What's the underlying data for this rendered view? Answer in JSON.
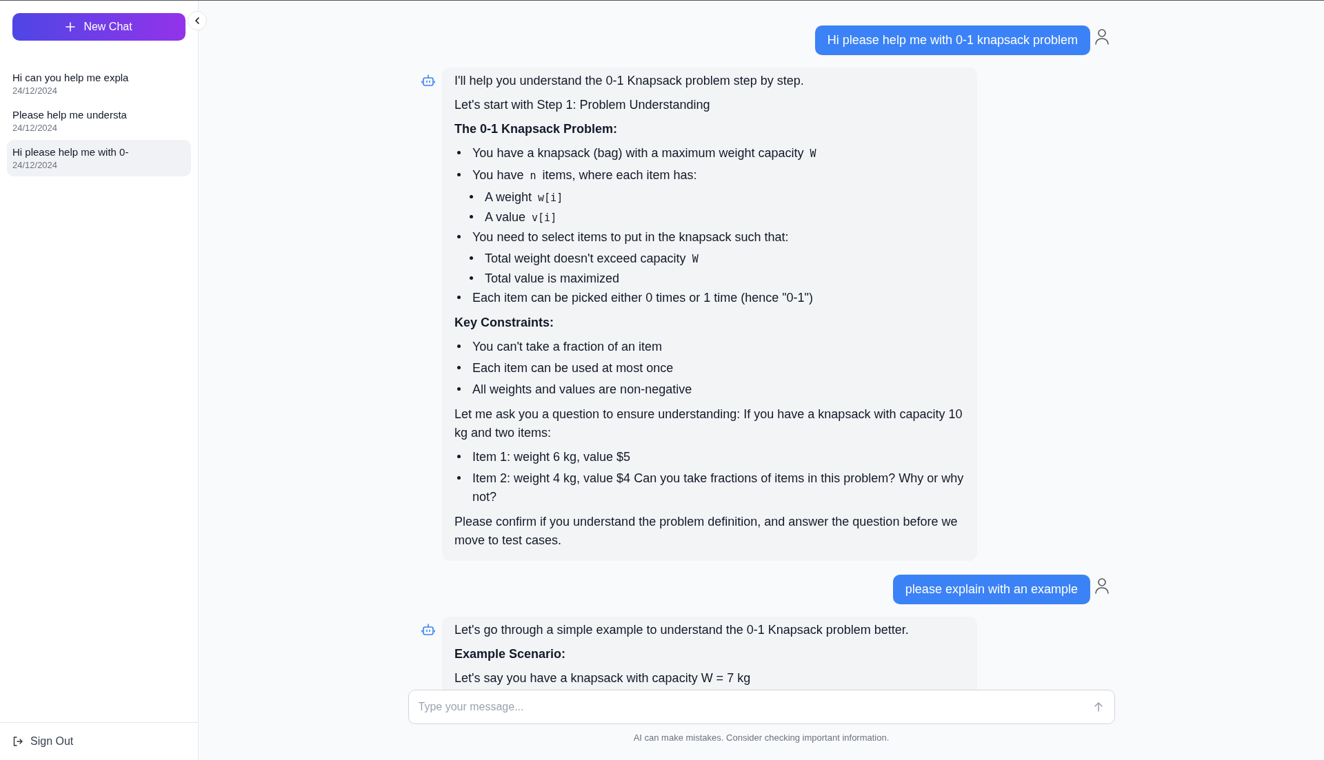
{
  "sidebar": {
    "new_chat_button": "New Chat",
    "chats": [
      {
        "title": "Hi can you help me expla",
        "date": "24/12/2024",
        "selected": false
      },
      {
        "title": "Please help me understa",
        "date": "24/12/2024",
        "selected": false
      },
      {
        "title": "Hi please help me with 0-",
        "date": "24/12/2024",
        "selected": true
      }
    ],
    "sign_out": "Sign Out"
  },
  "messages": [
    {
      "kind": "user",
      "text": "Hi please help me with 0-1 knapsack problem"
    },
    {
      "kind": "assistant",
      "blocks": [
        {
          "kind": "p",
          "text": "I'll help you understand the 0-1 Knapsack problem step by step."
        },
        {
          "kind": "p",
          "text": "Let's start with Step 1: Problem Understanding"
        },
        {
          "kind": "heading",
          "text": "The 0-1 Knapsack Problem:"
        },
        {
          "kind": "list",
          "items": [
            {
              "parts": [
                {
                  "kind": "text",
                  "text": "You have a knapsack (bag) with a maximum weight capacity "
                },
                {
                  "kind": "code",
                  "text": "W"
                }
              ]
            },
            {
              "parts": [
                {
                  "kind": "text",
                  "text": "You have "
                },
                {
                  "kind": "code",
                  "text": "n"
                },
                {
                  "kind": "text",
                  "text": " items, where each item has:"
                }
              ],
              "children": [
                {
                  "parts": [
                    {
                      "kind": "text",
                      "text": "A weight "
                    },
                    {
                      "kind": "code",
                      "text": "w[i]"
                    }
                  ]
                },
                {
                  "parts": [
                    {
                      "kind": "text",
                      "text": "A value "
                    },
                    {
                      "kind": "code",
                      "text": "v[i]"
                    }
                  ]
                }
              ]
            },
            {
              "parts": [
                {
                  "kind": "text",
                  "text": "You need to select items to put in the knapsack such that:"
                }
              ],
              "children": [
                {
                  "parts": [
                    {
                      "kind": "text",
                      "text": "Total weight doesn't exceed capacity "
                    },
                    {
                      "kind": "code",
                      "text": "W"
                    }
                  ]
                },
                {
                  "parts": [
                    {
                      "kind": "text",
                      "text": "Total value is maximized"
                    }
                  ]
                }
              ]
            },
            {
              "parts": [
                {
                  "kind": "text",
                  "text": "Each item can be picked either 0 times or 1 time (hence \"0-1\")"
                }
              ]
            }
          ]
        },
        {
          "kind": "heading",
          "text": "Key Constraints:"
        },
        {
          "kind": "list",
          "items": [
            {
              "parts": [
                {
                  "kind": "text",
                  "text": "You can't take a fraction of an item"
                }
              ]
            },
            {
              "parts": [
                {
                  "kind": "text",
                  "text": "Each item can be used at most once"
                }
              ]
            },
            {
              "parts": [
                {
                  "kind": "text",
                  "text": "All weights and values are non-negative"
                }
              ]
            }
          ]
        },
        {
          "kind": "p",
          "text": "Let me ask you a question to ensure understanding: If you have a knapsack with capacity 10 kg and two items:"
        },
        {
          "kind": "list",
          "items": [
            {
              "parts": [
                {
                  "kind": "text",
                  "text": "Item 1: weight 6 kg, value $5"
                }
              ]
            },
            {
              "parts": [
                {
                  "kind": "text",
                  "text": "Item 2: weight 4 kg, value $4 Can you take fractions of items in this problem? Why or why not?"
                }
              ]
            }
          ]
        },
        {
          "kind": "p",
          "text": "Please confirm if you understand the problem definition, and answer the question before we move to test cases."
        }
      ]
    },
    {
      "kind": "user",
      "text": "please explain with an example"
    },
    {
      "kind": "assistant",
      "blocks": [
        {
          "kind": "p",
          "text": "Let's go through a simple example to understand the 0-1 Knapsack problem better."
        },
        {
          "kind": "heading",
          "text": "Example Scenario:"
        },
        {
          "kind": "line",
          "text": "Let's say you have a knapsack with capacity W = 7 kg"
        }
      ]
    }
  ],
  "composer": {
    "placeholder": "Type your message..."
  },
  "disclaimer": "AI can make mistakes. Consider checking important information."
}
